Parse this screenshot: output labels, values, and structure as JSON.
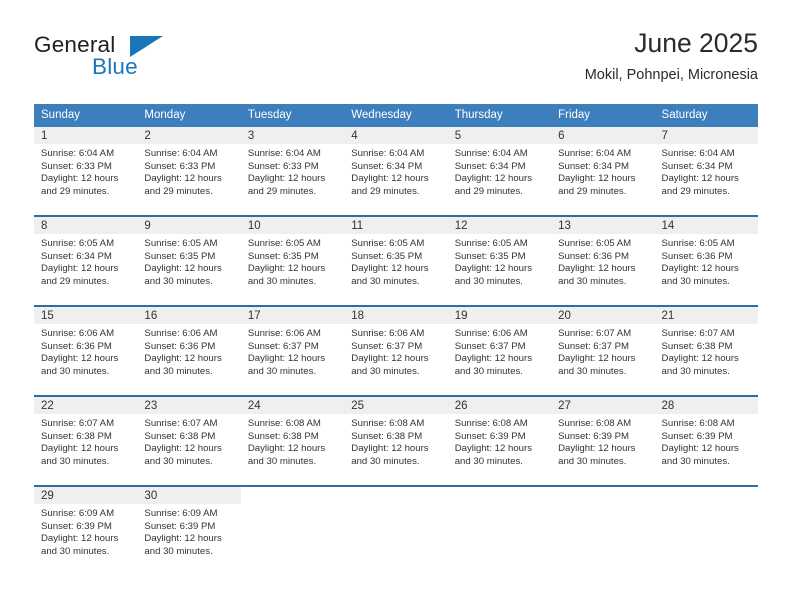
{
  "brand": {
    "word_general": "General",
    "word_blue": "Blue",
    "accent_color": "#1b75bb"
  },
  "header": {
    "title": "June 2025",
    "location": "Mokil, Pohnpei, Micronesia"
  },
  "calendar": {
    "header_bg": "#3d7ebd",
    "daynum_bg": "#efefef",
    "weekday_names": [
      "Sunday",
      "Monday",
      "Tuesday",
      "Wednesday",
      "Thursday",
      "Friday",
      "Saturday"
    ],
    "weeks": [
      [
        {
          "day": "1",
          "sunrise": "Sunrise: 6:04 AM",
          "sunset": "Sunset: 6:33 PM",
          "daylight": "Daylight: 12 hours and 29 minutes."
        },
        {
          "day": "2",
          "sunrise": "Sunrise: 6:04 AM",
          "sunset": "Sunset: 6:33 PM",
          "daylight": "Daylight: 12 hours and 29 minutes."
        },
        {
          "day": "3",
          "sunrise": "Sunrise: 6:04 AM",
          "sunset": "Sunset: 6:33 PM",
          "daylight": "Daylight: 12 hours and 29 minutes."
        },
        {
          "day": "4",
          "sunrise": "Sunrise: 6:04 AM",
          "sunset": "Sunset: 6:34 PM",
          "daylight": "Daylight: 12 hours and 29 minutes."
        },
        {
          "day": "5",
          "sunrise": "Sunrise: 6:04 AM",
          "sunset": "Sunset: 6:34 PM",
          "daylight": "Daylight: 12 hours and 29 minutes."
        },
        {
          "day": "6",
          "sunrise": "Sunrise: 6:04 AM",
          "sunset": "Sunset: 6:34 PM",
          "daylight": "Daylight: 12 hours and 29 minutes."
        },
        {
          "day": "7",
          "sunrise": "Sunrise: 6:04 AM",
          "sunset": "Sunset: 6:34 PM",
          "daylight": "Daylight: 12 hours and 29 minutes."
        }
      ],
      [
        {
          "day": "8",
          "sunrise": "Sunrise: 6:05 AM",
          "sunset": "Sunset: 6:34 PM",
          "daylight": "Daylight: 12 hours and 29 minutes."
        },
        {
          "day": "9",
          "sunrise": "Sunrise: 6:05 AM",
          "sunset": "Sunset: 6:35 PM",
          "daylight": "Daylight: 12 hours and 30 minutes."
        },
        {
          "day": "10",
          "sunrise": "Sunrise: 6:05 AM",
          "sunset": "Sunset: 6:35 PM",
          "daylight": "Daylight: 12 hours and 30 minutes."
        },
        {
          "day": "11",
          "sunrise": "Sunrise: 6:05 AM",
          "sunset": "Sunset: 6:35 PM",
          "daylight": "Daylight: 12 hours and 30 minutes."
        },
        {
          "day": "12",
          "sunrise": "Sunrise: 6:05 AM",
          "sunset": "Sunset: 6:35 PM",
          "daylight": "Daylight: 12 hours and 30 minutes."
        },
        {
          "day": "13",
          "sunrise": "Sunrise: 6:05 AM",
          "sunset": "Sunset: 6:36 PM",
          "daylight": "Daylight: 12 hours and 30 minutes."
        },
        {
          "day": "14",
          "sunrise": "Sunrise: 6:05 AM",
          "sunset": "Sunset: 6:36 PM",
          "daylight": "Daylight: 12 hours and 30 minutes."
        }
      ],
      [
        {
          "day": "15",
          "sunrise": "Sunrise: 6:06 AM",
          "sunset": "Sunset: 6:36 PM",
          "daylight": "Daylight: 12 hours and 30 minutes."
        },
        {
          "day": "16",
          "sunrise": "Sunrise: 6:06 AM",
          "sunset": "Sunset: 6:36 PM",
          "daylight": "Daylight: 12 hours and 30 minutes."
        },
        {
          "day": "17",
          "sunrise": "Sunrise: 6:06 AM",
          "sunset": "Sunset: 6:37 PM",
          "daylight": "Daylight: 12 hours and 30 minutes."
        },
        {
          "day": "18",
          "sunrise": "Sunrise: 6:06 AM",
          "sunset": "Sunset: 6:37 PM",
          "daylight": "Daylight: 12 hours and 30 minutes."
        },
        {
          "day": "19",
          "sunrise": "Sunrise: 6:06 AM",
          "sunset": "Sunset: 6:37 PM",
          "daylight": "Daylight: 12 hours and 30 minutes."
        },
        {
          "day": "20",
          "sunrise": "Sunrise: 6:07 AM",
          "sunset": "Sunset: 6:37 PM",
          "daylight": "Daylight: 12 hours and 30 minutes."
        },
        {
          "day": "21",
          "sunrise": "Sunrise: 6:07 AM",
          "sunset": "Sunset: 6:38 PM",
          "daylight": "Daylight: 12 hours and 30 minutes."
        }
      ],
      [
        {
          "day": "22",
          "sunrise": "Sunrise: 6:07 AM",
          "sunset": "Sunset: 6:38 PM",
          "daylight": "Daylight: 12 hours and 30 minutes."
        },
        {
          "day": "23",
          "sunrise": "Sunrise: 6:07 AM",
          "sunset": "Sunset: 6:38 PM",
          "daylight": "Daylight: 12 hours and 30 minutes."
        },
        {
          "day": "24",
          "sunrise": "Sunrise: 6:08 AM",
          "sunset": "Sunset: 6:38 PM",
          "daylight": "Daylight: 12 hours and 30 minutes."
        },
        {
          "day": "25",
          "sunrise": "Sunrise: 6:08 AM",
          "sunset": "Sunset: 6:38 PM",
          "daylight": "Daylight: 12 hours and 30 minutes."
        },
        {
          "day": "26",
          "sunrise": "Sunrise: 6:08 AM",
          "sunset": "Sunset: 6:39 PM",
          "daylight": "Daylight: 12 hours and 30 minutes."
        },
        {
          "day": "27",
          "sunrise": "Sunrise: 6:08 AM",
          "sunset": "Sunset: 6:39 PM",
          "daylight": "Daylight: 12 hours and 30 minutes."
        },
        {
          "day": "28",
          "sunrise": "Sunrise: 6:08 AM",
          "sunset": "Sunset: 6:39 PM",
          "daylight": "Daylight: 12 hours and 30 minutes."
        }
      ],
      [
        {
          "day": "29",
          "sunrise": "Sunrise: 6:09 AM",
          "sunset": "Sunset: 6:39 PM",
          "daylight": "Daylight: 12 hours and 30 minutes."
        },
        {
          "day": "30",
          "sunrise": "Sunrise: 6:09 AM",
          "sunset": "Sunset: 6:39 PM",
          "daylight": "Daylight: 12 hours and 30 minutes."
        },
        {
          "day": "",
          "sunrise": "",
          "sunset": "",
          "daylight": ""
        },
        {
          "day": "",
          "sunrise": "",
          "sunset": "",
          "daylight": ""
        },
        {
          "day": "",
          "sunrise": "",
          "sunset": "",
          "daylight": ""
        },
        {
          "day": "",
          "sunrise": "",
          "sunset": "",
          "daylight": ""
        },
        {
          "day": "",
          "sunrise": "",
          "sunset": "",
          "daylight": ""
        }
      ]
    ]
  }
}
